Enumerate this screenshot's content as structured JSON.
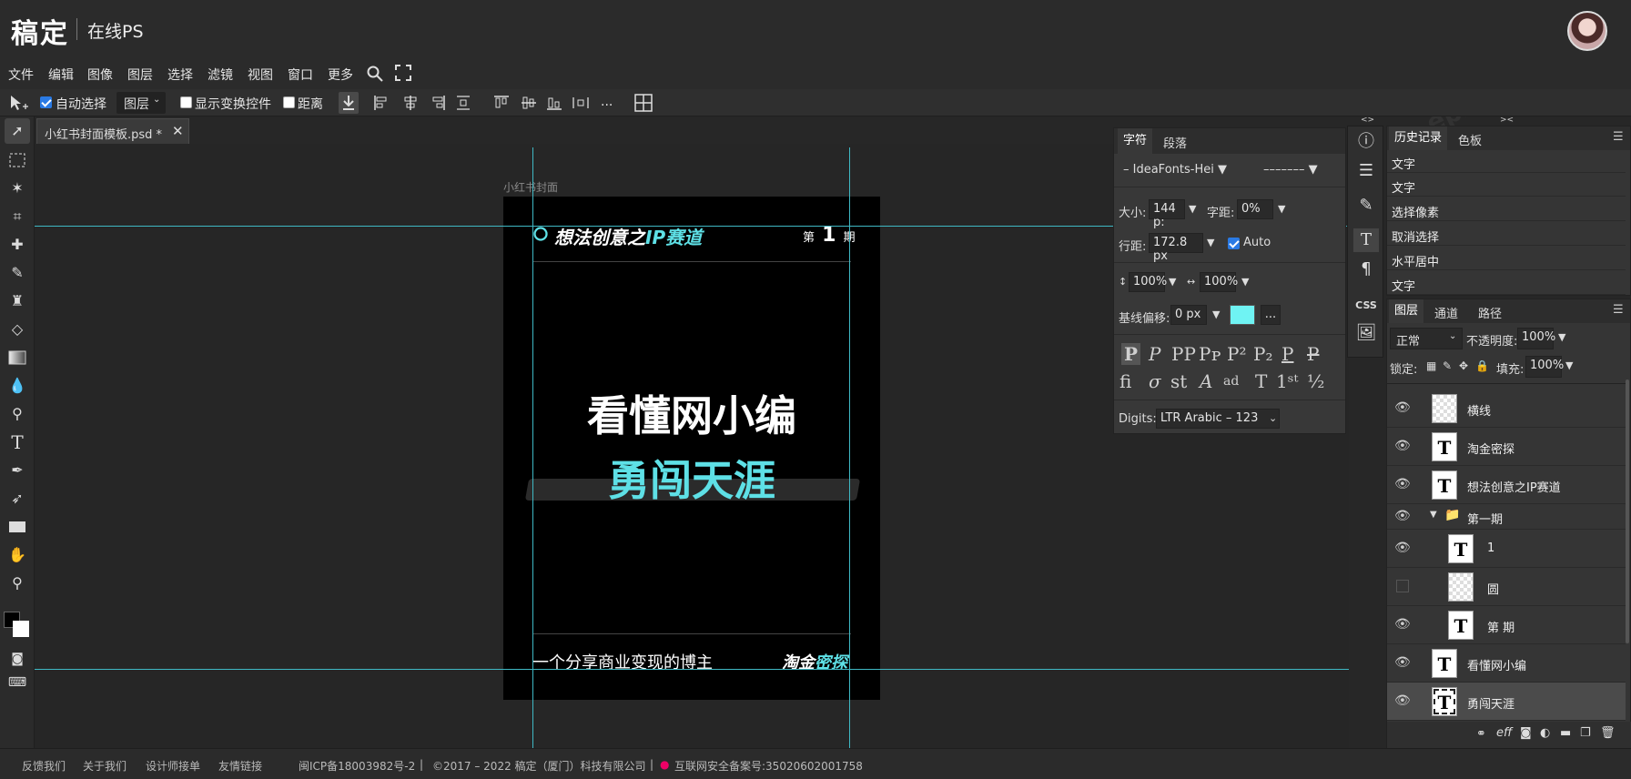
{
  "header": {
    "logo": "稿定",
    "subtitle": "在线PS"
  },
  "menu": [
    "文件",
    "编辑",
    "图像",
    "图层",
    "选择",
    "滤镜",
    "视图",
    "窗口",
    "更多"
  ],
  "options": {
    "auto_select": "自动选择",
    "layer_select": "图层",
    "show_transform": "显示变换控件",
    "distance": "距离",
    "more": "..."
  },
  "tab": {
    "title": "小红书封面模板.psd *",
    "close": "✕"
  },
  "artboard": {
    "label": "小红书封面",
    "header_text_white": "想法创意之",
    "header_text_cyan": "IP赛道",
    "issue_pre": "第",
    "issue_num": "1",
    "issue_post": "期",
    "main_title": "看懂网小编",
    "sub_title": "勇闯天涯",
    "footer_left": "一个分享商业变现的博主",
    "footer_right_white": "淘金",
    "footer_right_cyan": "密探"
  },
  "char_panel": {
    "tab1": "字符",
    "tab2": "段落",
    "font_family": "– IdeaFonts-Hei ▼",
    "font_style": "––––––– ▼",
    "size_label": "大小:",
    "size_value": "144 p:",
    "tracking_label": "字距:",
    "tracking_value": "0%",
    "leading_label": "行距:",
    "leading_value": "172.8 px",
    "auto_label": "Auto",
    "vscale_value": "100%",
    "hscale_value": "100%",
    "baseline_label": "基线偏移:",
    "baseline_value": "0 px",
    "more": "...",
    "digits_label": "Digits:",
    "digits_value": "LTR Arabic – 123"
  },
  "history_panel": {
    "tab1": "历史记录",
    "tab2": "色板",
    "items": [
      "文字",
      "文字",
      "选择像素",
      "取消选择",
      "水平居中",
      "文字"
    ]
  },
  "layers_panel": {
    "tab1": "图层",
    "tab2": "通道",
    "tab3": "路径",
    "blend_mode": "正常",
    "opacity_label": "不透明度:",
    "opacity_value": "100%",
    "lock_label": "锁定:",
    "fill_label": "填充:",
    "fill_value": "100%",
    "layers": [
      {
        "name": "横线",
        "type": "pattern"
      },
      {
        "name": "淘金密探",
        "type": "text"
      },
      {
        "name": "想法创意之IP赛道",
        "type": "text"
      },
      {
        "name": "第一期",
        "type": "folder"
      },
      {
        "name": "1",
        "type": "text"
      },
      {
        "name": "圆",
        "type": "pattern"
      },
      {
        "name": "第 期",
        "type": "text"
      },
      {
        "name": "看懂网小编",
        "type": "text"
      },
      {
        "name": "勇闯天涯",
        "type": "text"
      }
    ]
  },
  "footer": {
    "links": [
      "反馈我们",
      "关于我们",
      "设计师接单",
      "友情链接"
    ],
    "icp": "闽ICP备18003982号-2",
    "copyright": "©2017 – 2022 稿定（厦门）科技有限公司",
    "police": "互联网安全备案号:35020602001758"
  },
  "colors": {
    "accent_cyan": "#5ee0e6",
    "guide": "#3fb8c4"
  }
}
